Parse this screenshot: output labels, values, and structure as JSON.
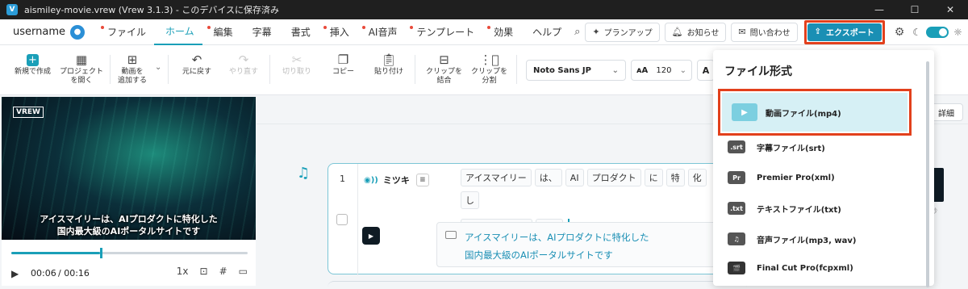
{
  "window": {
    "title": "aismiley-movie.vrew (Vrew 3.1.3) - このデバイスに保存済み",
    "logo_letter": "V",
    "controls": [
      "—",
      "☐",
      "✕"
    ]
  },
  "menubar": {
    "username": "username",
    "items": [
      {
        "label": "ファイル",
        "dot": true
      },
      {
        "label": "ホーム",
        "dot": false,
        "active": true
      },
      {
        "label": "編集",
        "dot": true
      },
      {
        "label": "字幕",
        "dot": false
      },
      {
        "label": "書式",
        "dot": false
      },
      {
        "label": "挿入",
        "dot": true
      },
      {
        "label": "AI音声",
        "dot": true
      },
      {
        "label": "テンプレート",
        "dot": true
      },
      {
        "label": "効果",
        "dot": true
      },
      {
        "label": "ヘルプ",
        "dot": false
      }
    ],
    "plan_up": "プランアップ",
    "notice": "お知らせ",
    "contact": "問い合わせ",
    "export": "エクスポート"
  },
  "toolbar": {
    "new_project": "新規で作成",
    "open_project": "プロジェクト\nを開く",
    "add_video": "動画を\n追加する",
    "undo": "元に戻す",
    "redo": "やり直す",
    "cut": "切り取り",
    "copy": "コピー",
    "paste": "貼り付け",
    "merge_clip": "クリップを\n結合",
    "split_clip": "クリップを\n分割",
    "font": "Noto Sans JP",
    "size_icon": "ᴀA",
    "size": "120",
    "format_btn": "A"
  },
  "video": {
    "logo": "VREW",
    "subtitle_line1": "アイスマイリーは、AIプロダクトに特化した",
    "subtitle_line2": "国内最大級のAIポータルサイトです",
    "progress": 0.375,
    "time_current": "00:06",
    "time_total": "/ 00:16",
    "speed": "1x"
  },
  "editor": {
    "detail_btn": "詳細",
    "clip_number": "1",
    "speaker": "ミツキ",
    "words_line1": [
      "アイスマイリー",
      "は、",
      "AI",
      "プロダクト",
      "に",
      "特",
      "化",
      "し"
    ],
    "words_line2": [
      "ポータルサイト",
      "です"
    ],
    "subtitle_line1": "アイスマイリーは、AIプロダクトに特化した",
    "subtitle_line2": "国内最大級のAIポータルサイトです",
    "side_label": "秒"
  },
  "export_menu": {
    "title": "ファイル形式",
    "items": [
      {
        "icon": "▶",
        "label": "動画ファイル(mp4)"
      },
      {
        "icon": ".srt",
        "label": "字幕ファイル(srt)"
      },
      {
        "icon": "Pr",
        "label": "Premier Pro(xml)"
      },
      {
        "icon": ".txt",
        "label": "テキストファイル(txt)"
      },
      {
        "icon": "♫",
        "label": "音声ファイル(mp3, wav)"
      },
      {
        "icon": "🎬",
        "label": "Final Cut Pro(fcpxml)"
      }
    ]
  },
  "colors": {
    "accent": "#1a9fb8",
    "export_bg": "#1a8fb4",
    "highlight_border": "#e2401c"
  }
}
